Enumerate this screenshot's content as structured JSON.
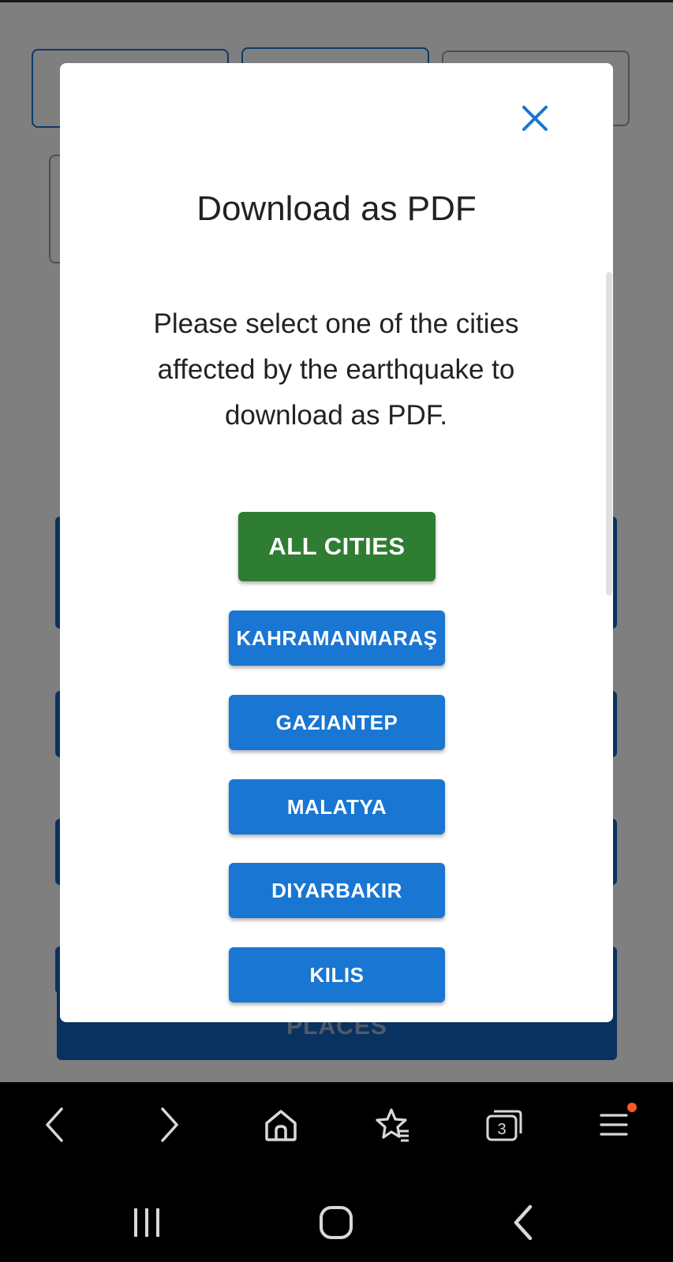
{
  "modal": {
    "title": "Download as PDF",
    "description": "Please select one of the cities affected by the earthquake to download as PDF.",
    "all_cities_label": "ALL CITIES",
    "cities": [
      "KAHRAMANMARAŞ",
      "GAZIANTEP",
      "MALATYA",
      "DIYARBAKIR",
      "KILIS"
    ],
    "close_icon": "close-icon"
  },
  "background": {
    "places_label": "PLACES"
  },
  "browser": {
    "tab_count": "3",
    "icons": [
      "back-icon",
      "forward-icon",
      "home-icon",
      "bookmarks-icon",
      "tabs-icon",
      "menu-icon"
    ]
  },
  "system_nav": {
    "icons": [
      "recent-apps-icon",
      "home-button-icon",
      "back-nav-icon"
    ]
  },
  "colors": {
    "primary": "#1976d2",
    "green": "#2e7d32",
    "notification_dot": "#ff5722"
  }
}
